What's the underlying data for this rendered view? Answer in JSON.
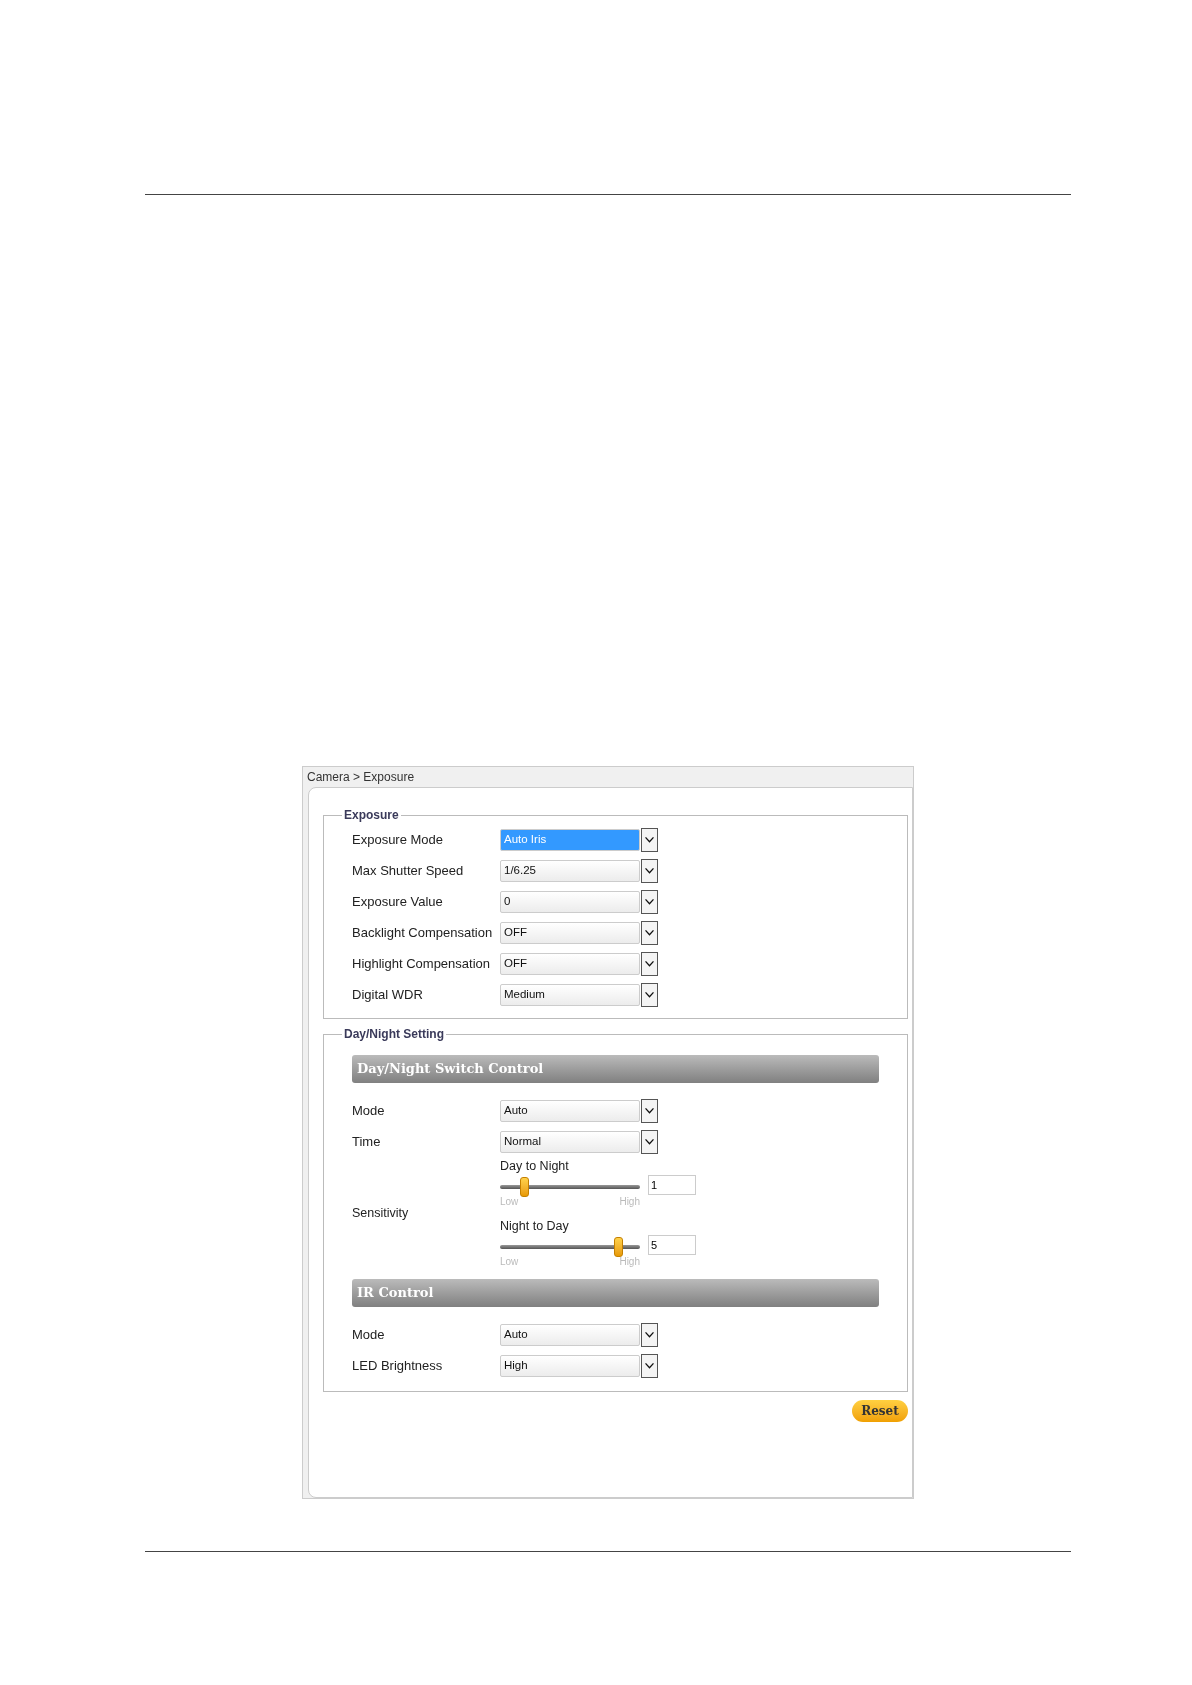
{
  "breadcrumb": "Camera > Exposure",
  "exposure": {
    "legend": "Exposure",
    "rows": [
      {
        "label": "Exposure Mode",
        "value": "Auto Iris",
        "highlighted": true
      },
      {
        "label": "Max Shutter Speed",
        "value": "1/6.25",
        "highlighted": false
      },
      {
        "label": "Exposure Value",
        "value": "0",
        "highlighted": false
      },
      {
        "label": "Backlight Compensation",
        "value": "OFF",
        "highlighted": false
      },
      {
        "label": "Highlight Compensation",
        "value": "OFF",
        "highlighted": false
      },
      {
        "label": "Digital WDR",
        "value": "Medium",
        "highlighted": false
      }
    ]
  },
  "day_night": {
    "legend": "Day/Night Setting",
    "switch_control": {
      "title": "Day/Night Switch Control",
      "rows": [
        {
          "label": "Mode",
          "value": "Auto",
          "highlighted": false
        },
        {
          "label": "Time",
          "value": "Normal",
          "highlighted": false
        }
      ],
      "sensitivity": {
        "label": "Sensitivity",
        "sliders": [
          {
            "title": "Day to Night",
            "level": 0.17,
            "low": "Low",
            "high": "High",
            "value": "1"
          },
          {
            "title": "Night to Day",
            "level": 0.84,
            "low": "Low",
            "high": "High",
            "value": "5"
          }
        ]
      }
    },
    "ir_control": {
      "title": "IR Control",
      "rows": [
        {
          "label": "Mode",
          "value": "Auto",
          "highlighted": false
        },
        {
          "label": "LED Brightness",
          "value": "High",
          "highlighted": false
        }
      ]
    }
  },
  "reset_button": "Reset"
}
